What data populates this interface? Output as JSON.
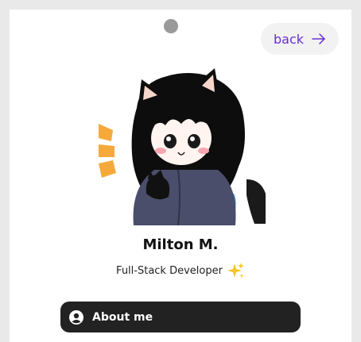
{
  "header": {
    "back_label": "back",
    "back_icon": "arrow-right-icon",
    "camera_dot_color": "#9a9a9a"
  },
  "profile": {
    "avatar_icon": "anime-cat-girl-avatar",
    "name": "Milton M.",
    "role": "Full-Stack Developer",
    "role_icon": "sparkles-icon"
  },
  "actions": {
    "about_label": "About me",
    "about_icon": "user-circle-icon"
  },
  "colors": {
    "accent": "#6a2fd6",
    "button_dark": "#222222",
    "sparkle": "#f5c623",
    "avatar_stripes": "#f6a93b"
  }
}
